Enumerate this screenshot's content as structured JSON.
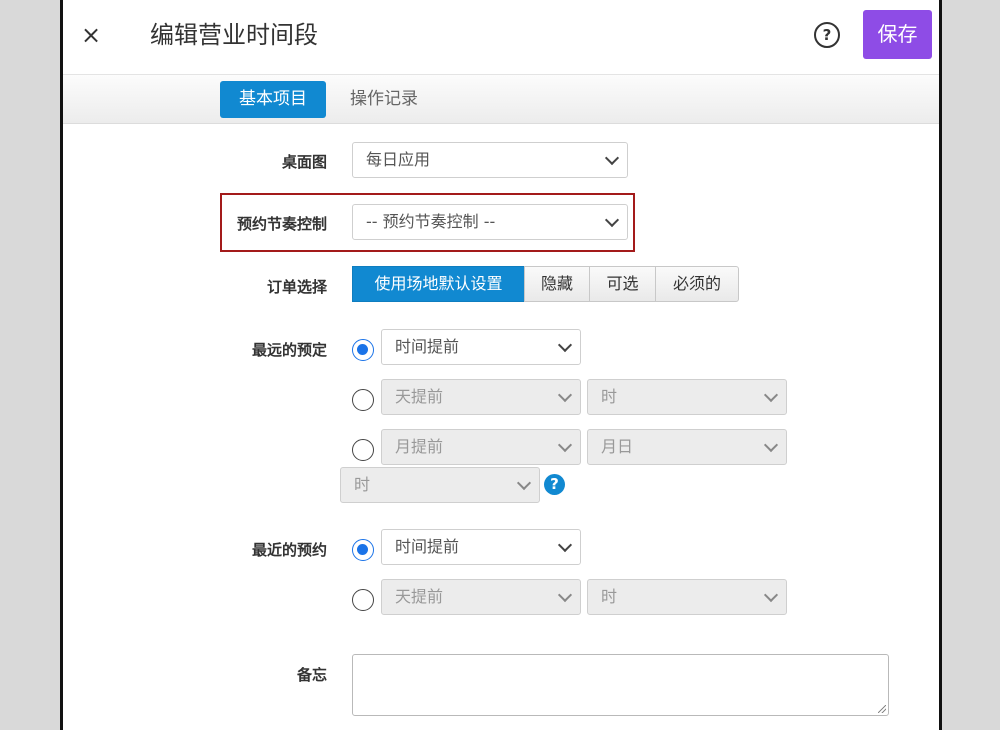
{
  "header": {
    "title": "编辑营业时间段",
    "save_label": "保存",
    "help_label": "?",
    "close_label": "×"
  },
  "tabs": [
    {
      "label": "基本项目",
      "active": true
    },
    {
      "label": "操作记录",
      "active": false
    }
  ],
  "form": {
    "desk_view": {
      "label": "桌面图",
      "value": "每日应用"
    },
    "rhythm_control": {
      "label": "预约节奏控制",
      "value": "-- 预约节奏控制 --"
    },
    "order_choice": {
      "label": "订单选择",
      "options": [
        "使用场地默认设置",
        "隐藏",
        "可选",
        "必须的"
      ],
      "selected": "使用场地默认设置"
    },
    "latest_booking": {
      "label": "最远的预定",
      "row1": {
        "checked": true,
        "unit": "时间提前"
      },
      "row2": {
        "checked": false,
        "unit": "天提前",
        "time": "时"
      },
      "row3": {
        "checked": false,
        "unit": "月提前",
        "date": "月日",
        "time": "时"
      }
    },
    "nearest_booking": {
      "label": "最近的预约",
      "row1": {
        "checked": true,
        "unit": "时间提前"
      },
      "row2": {
        "checked": false,
        "unit": "天提前",
        "time": "时"
      }
    },
    "memo": {
      "label": "备忘",
      "value": ""
    }
  },
  "colors": {
    "accent": "#1189d1",
    "save": "#8e4ce6",
    "highlight": "#a31a1a",
    "radio": "#1a73e8"
  }
}
